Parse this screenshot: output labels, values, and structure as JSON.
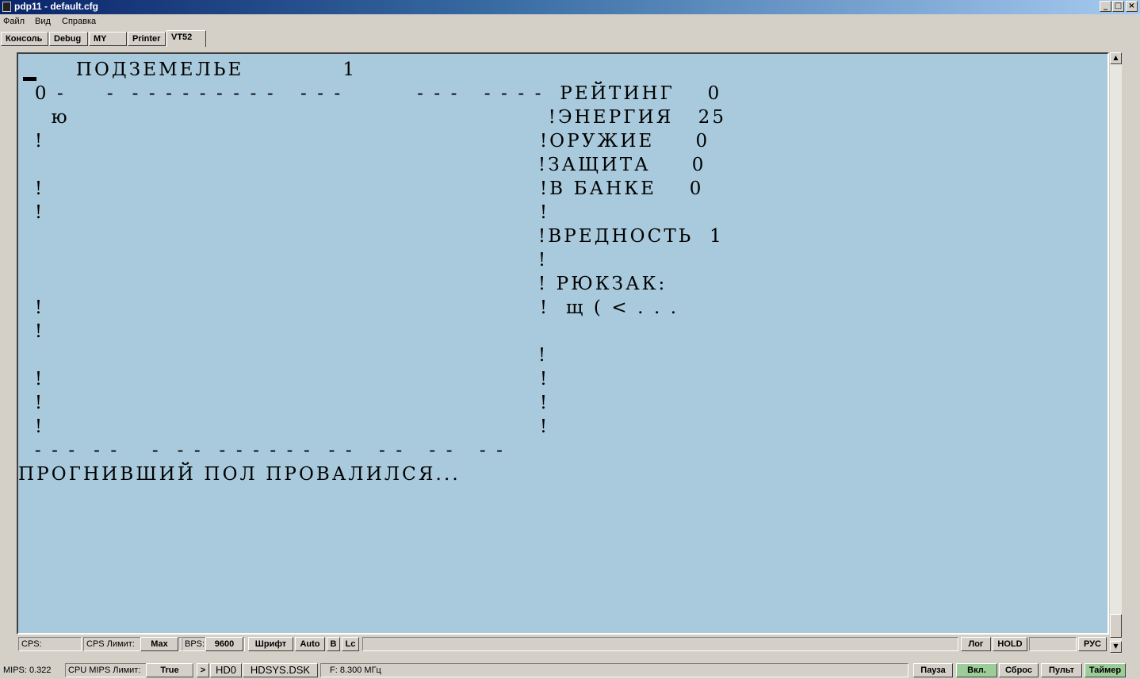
{
  "window": {
    "title": "pdp11 - default.cfg",
    "controls": {
      "minimize": "_",
      "maximize": "□",
      "close": "×"
    }
  },
  "menu": [
    "Файл",
    "Вид",
    "Справка"
  ],
  "tabs": [
    "Консоль",
    "Debug",
    "MY",
    "Printer",
    "VT52"
  ],
  "terminal": {
    "lines": [
      "       ПОДЗЕМЕЛЬЕ            1",
      "  0 -     -  - - - - - - - - -   - - -         - - -   - - - -  РЕЙТИНГ    0",
      "    ю                                                          !ЭНЕРГИЯ   25",
      "  !                                                            !ОРУЖИЕ     0",
      "                                                               !ЗАЩИТА     0",
      "  !                                                            !В БАНКЕ    0",
      "  !                                                            !",
      "                                                               !ВРЕДНОСТЬ  1",
      "                                                               !",
      "                                                               ! РЮКЗАК:",
      "  !                                                            !  щ ( < . . .",
      "  !",
      "                                                               !",
      "  !                                                            !",
      "  !                                                            !",
      "  !                                                            !",
      "  - - -  - -    -  - -  - - - - - -  - -   - -   - -   - -",
      "ПРОГНИВШИЙ ПОЛ ПРОВАЛИЛСЯ..."
    ]
  },
  "scrollbar": {
    "up": "▲",
    "down": "▼"
  },
  "term_status": {
    "cps_label": "CPS:",
    "cps_limit_label": "CPS Лимит:",
    "cps_limit_value": "Max",
    "bps_label": "BPS:",
    "bps_value": "9600",
    "font_button": "Шрифт",
    "auto_button": "Auto",
    "b_button": "B",
    "lc_button": "Lc",
    "log_button": "Лог",
    "hold_button": "HOLD",
    "rus_button": "РУС"
  },
  "main_status": {
    "mips": "MIPS:  0.322",
    "cpu_mips_limit_label": "CPU MIPS Лимит:",
    "cpu_mips_limit_value": "True",
    "arrow_button": ">",
    "drive": "HD0",
    "disk_file": "HDSYS.DSK",
    "freq": "F: 8.300 МГц",
    "pause_button": "Пауза",
    "on_button": "Вкл.",
    "reset_button": "Сброс",
    "panel_button": "Пульт",
    "timer_button": "Таймер"
  },
  "colors": {
    "terminal_bg": "#a8cadc",
    "active_button": "#9ccc98"
  }
}
